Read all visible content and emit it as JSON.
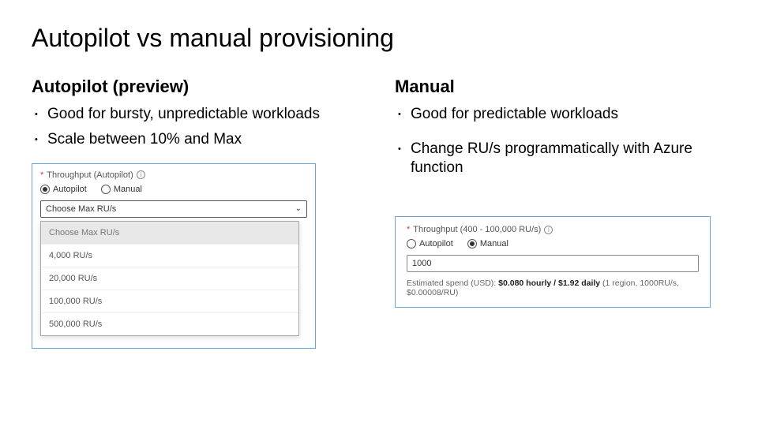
{
  "title": "Autopilot vs manual provisioning",
  "left": {
    "heading": "Autopilot (preview)",
    "bullets": [
      "Good for bursty, unpredictable workloads",
      "Scale between 10% and Max"
    ],
    "panel": {
      "asterisk": "*",
      "label": "Throughput (Autopilot)",
      "radio_autopilot": "Autopilot",
      "radio_manual": "Manual",
      "select_value": "Choose Max RU/s",
      "dropdown": {
        "header": "Choose Max RU/s",
        "options": [
          "4,000 RU/s",
          "20,000 RU/s",
          "100,000 RU/s",
          "500,000 RU/s"
        ]
      }
    }
  },
  "right": {
    "heading": "Manual",
    "bullets": [
      "Good for predictable workloads",
      "Change RU/s programmatically with Azure function"
    ],
    "panel": {
      "asterisk": "*",
      "label": "Throughput (400 - 100,000 RU/s)",
      "radio_autopilot": "Autopilot",
      "radio_manual": "Manual",
      "input_value": "1000",
      "estimate_prefix": "Estimated spend (USD): ",
      "estimate_bold": "$0.080 hourly / $1.92 daily",
      "estimate_suffix": " (1 region, 1000RU/s, $0.00008/RU)"
    }
  }
}
